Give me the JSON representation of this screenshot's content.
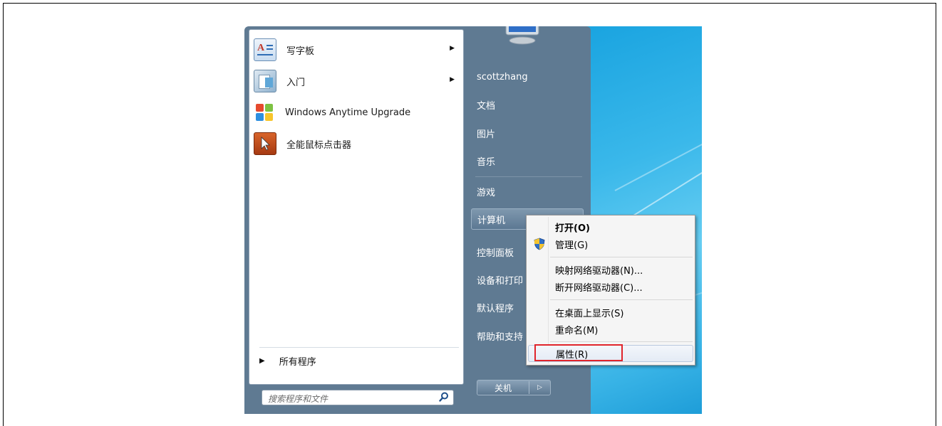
{
  "start_menu": {
    "programs": [
      {
        "label": "写字板",
        "icon": "wordpad-icon",
        "has_submenu": true
      },
      {
        "label": "入门",
        "icon": "getting-started-icon",
        "has_submenu": true
      },
      {
        "label": "Windows Anytime Upgrade",
        "icon": "windows-logo-icon",
        "has_submenu": false
      },
      {
        "label": "全能鼠标点击器",
        "icon": "mouse-clicker-icon",
        "has_submenu": false
      }
    ],
    "all_programs_label": "所有程序",
    "search_placeholder": "搜索程序和文件",
    "right_items": {
      "user": "scottzhang",
      "documents": "文档",
      "pictures": "图片",
      "music": "音乐",
      "games": "游戏",
      "computer": "计算机",
      "control_panel": "控制面板",
      "devices_printers": "设备和打印",
      "default_programs": "默认程序",
      "help_support": "帮助和支持"
    },
    "shutdown_label": "关机"
  },
  "context_menu": {
    "open": "打开(O)",
    "manage": "管理(G)",
    "map_drive": "映射网络驱动器(N)...",
    "disconnect_drive": "断开网络驱动器(C)...",
    "show_on_desktop": "在桌面上显示(S)",
    "rename": "重命名(M)",
    "properties": "属性(R)"
  },
  "colors": {
    "highlight_box": "#e0242b",
    "start_menu_bg": "#5f7a92",
    "wallpaper": "#38b3e6"
  }
}
